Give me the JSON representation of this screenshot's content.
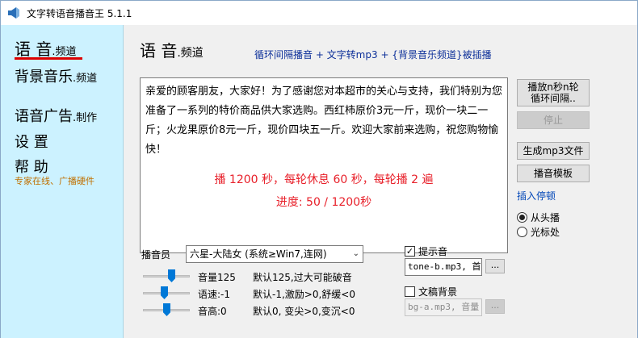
{
  "window": {
    "title": "文字转语音播音王 5.1.1",
    "icon": "speaker-icon"
  },
  "sidebar": {
    "items": [
      {
        "main": "语 音",
        "suffix": ".频道",
        "active": true
      },
      {
        "main": "背景音乐",
        "suffix": ".频道"
      },
      {
        "main": "语音广告",
        "suffix": ".制作"
      },
      {
        "main": "设 置",
        "suffix": ""
      },
      {
        "main": "帮 助",
        "suffix": ""
      }
    ],
    "help_sub": "专家在线、广播硬件"
  },
  "main": {
    "title": "语 音",
    "title_suffix": ".频道",
    "subtitle": "循环间隔播音 + 文字转mp3 + {背景音乐频道}被插播",
    "text": "亲爱的顾客朋友，大家好！为了感谢您对本超市的关心与支持，我们特别为您准备了一系列的特价商品供大家选购。西红柿原价3元一斤，现价一块二一斤；火龙果原价8元一斤，现价四块五一斤。欢迎大家前来选购，祝您购物愉快！",
    "status_line1": "播 1200 秒，每轮休息 60 秒，每轮播 2 遍",
    "status_line2": "进度:  50 / 1200秒"
  },
  "buttons": {
    "play_line1": "播放n秒n轮",
    "play_line2": "循环间隔..",
    "stop": "停止",
    "make_mp3": "生成mp3文件",
    "template": "播音模板",
    "insert_pause": "插入停顿",
    "browse": "..."
  },
  "play_from": {
    "options": [
      "从头播",
      "光标处"
    ],
    "selected": 0
  },
  "voice": {
    "label": "播音员",
    "selected": "六星-大陆女 (系统≥Win7,连网)"
  },
  "sliders": [
    {
      "label": "音量125",
      "desc": "默认125,过大可能破音",
      "value": 125,
      "min": 0,
      "max": 200
    },
    {
      "label": "语速:-1",
      "desc": "默认-1,激励>0,舒缓<0",
      "value": -1,
      "min": -10,
      "max": 10
    },
    {
      "label": "音高:0",
      "desc": "默认0, 变尖>0,变沉<0",
      "value": 0,
      "min": -10,
      "max": 10
    }
  ],
  "prompt_sound": {
    "label": "提示音",
    "checked": true,
    "file": "tone-b.mp3, 首"
  },
  "script_bg": {
    "label": "文稿背景",
    "checked": false,
    "file": "bg-a.mp3, 音量"
  },
  "colors": {
    "sidebar_bg": "#ccf2ff",
    "status_red": "#e8202a",
    "link_blue": "#0046b8",
    "underline_red": "#dd0000"
  }
}
